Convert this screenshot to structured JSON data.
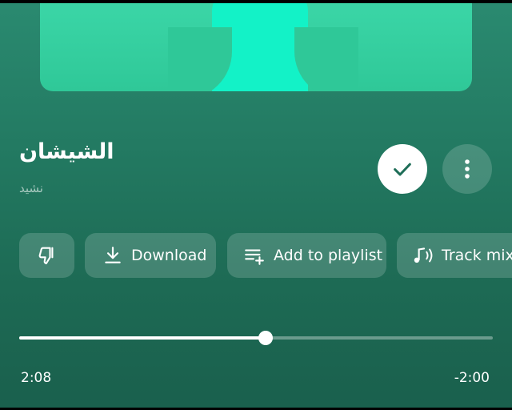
{
  "track": {
    "title": "الشيشان",
    "subtitle": "نشيد"
  },
  "actions": {
    "saved_icon": "check-icon",
    "more_icon": "more-vertical-icon"
  },
  "chips": [
    {
      "icon": "thumbs-down-icon",
      "label": ""
    },
    {
      "icon": "download-icon",
      "label": "Download"
    },
    {
      "icon": "add-to-playlist-icon",
      "label": "Add to playlist"
    },
    {
      "icon": "track-mix-icon",
      "label": "Track mix"
    }
  ],
  "player": {
    "elapsed": "2:08",
    "remaining": "-2:00",
    "progress": 0.52
  },
  "colors": {
    "background": "#237a62",
    "accent": "#ffffff",
    "artwork": "#2fc898"
  }
}
